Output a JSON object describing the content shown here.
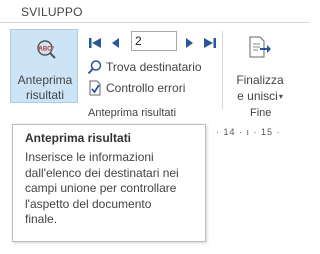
{
  "tabs": {
    "active": "SVILUPPO"
  },
  "preview_group": {
    "preview_button": {
      "line1": "Anteprima",
      "line2": "risultati"
    },
    "record_input": {
      "value": "2"
    },
    "find_recipient_label": "Trova destinatario",
    "check_errors_label": "Controllo errori",
    "group_label": "Anteprima risultati"
  },
  "finish_group": {
    "finish_button": {
      "line1": "Finalizza",
      "line2": "e unisci"
    },
    "group_label": "Fine"
  },
  "ruler": {
    "text": "· 14 · ı · 15 ·"
  },
  "tooltip": {
    "title": "Anteprima risultati",
    "lines": [
      "Inserisce le informazioni",
      "dall'elenco dei destinatari nei",
      "campi unione per controllare",
      "l'aspetto del documento",
      "finale."
    ]
  },
  "icons": {
    "preview": "abc-magnifier-icon",
    "first": "first-record-icon",
    "prev": "previous-record-icon",
    "next": "next-record-icon",
    "last": "last-record-icon",
    "find": "find-recipient-icon",
    "check": "check-errors-icon",
    "finish": "finish-merge-icon"
  },
  "colors": {
    "accent_blue": "#2b579a",
    "selected_bg": "#cde4f7",
    "selected_border": "#a9cde9"
  }
}
